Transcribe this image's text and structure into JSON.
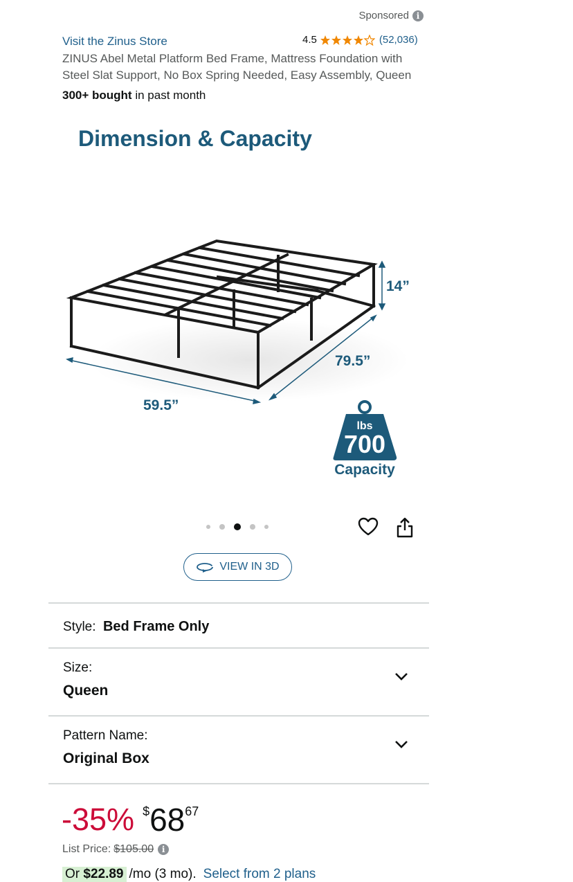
{
  "header": {
    "sponsored": "Sponsored",
    "store_link": "Visit the Zinus Store",
    "rating_value": "4.5",
    "rating_stars": 4.5,
    "rating_count": "(52,036)",
    "title": "ZINUS Abel Metal Platform Bed Frame, Mattress Foundation with Steel Slat Support, No Box Spring Needed, Easy Assembly, Queen",
    "bought_bold": "300+ bought",
    "bought_rest": " in past month"
  },
  "hero": {
    "heading": "Dimension & Capacity",
    "height_label": "14”",
    "length_label": "79.5”",
    "width_label": "59.5”",
    "weight_unit": "lbs",
    "weight_value": "700",
    "weight_caption": "Capacity"
  },
  "carousel": {
    "count": 5,
    "active_index": 2
  },
  "view3d": {
    "label": "VIEW IN 3D"
  },
  "variations": {
    "style_label": "Style:",
    "style_value": "Bed Frame Only",
    "size_label": "Size:",
    "size_value": "Queen",
    "pattern_label": "Pattern Name:",
    "pattern_value": "Original Box"
  },
  "price": {
    "discount": "-35%",
    "currency": "$",
    "whole": "68",
    "fraction": "67",
    "list_label": "List Price:",
    "list_value": "$105.00",
    "installment_prefix": "Or",
    "installment_amount": "$22.89",
    "installment_suffix": "/mo (3 mo).",
    "plans_link": "Select from 2 plans"
  },
  "colors": {
    "link": "#1f5f8b",
    "star": "#f08804",
    "deal_red": "#cc0c39",
    "brand_blue": "#1d5a7a"
  }
}
